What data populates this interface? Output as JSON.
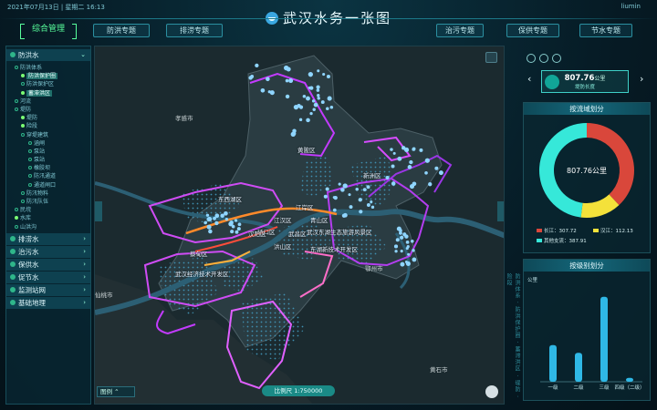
{
  "header": {
    "datetime": "2021年07月13日 | 星期二 16:13",
    "title": "武汉水务一张图",
    "user": "liumin",
    "tabs_left": [
      "综合管理",
      "防洪专题",
      "排涝专题"
    ],
    "tabs_right": [
      "治污专题",
      "保供专题",
      "节水专题"
    ]
  },
  "sidebar": {
    "groups": [
      {
        "label": "防洪水",
        "expanded": true
      },
      {
        "label": "排涝水"
      },
      {
        "label": "治污水"
      },
      {
        "label": "保供水"
      },
      {
        "label": "促节水"
      },
      {
        "label": "监测站网"
      },
      {
        "label": "基础地理"
      }
    ],
    "tree": [
      {
        "label": "防洪体系",
        "level": 1,
        "on": false
      },
      {
        "label": "防洪保护圈",
        "level": 2,
        "on": true,
        "highlight": true
      },
      {
        "label": "防洪保护区",
        "level": 2,
        "on": false
      },
      {
        "label": "蓄滞洪区",
        "level": 2,
        "on": true,
        "highlight": true
      },
      {
        "label": "河流",
        "level": 1,
        "on": false
      },
      {
        "label": "堤防",
        "level": 1,
        "on": false
      },
      {
        "label": "堤防",
        "level": 2,
        "on": true
      },
      {
        "label": "险段",
        "level": 2,
        "on": true
      },
      {
        "label": "穿堤建筑",
        "level": 2,
        "on": false
      },
      {
        "label": "涵闸",
        "level": 3,
        "on": false
      },
      {
        "label": "泵站",
        "level": 3,
        "on": false
      },
      {
        "label": "泵站",
        "level": 3,
        "on": false
      },
      {
        "label": "橡胶坝",
        "level": 3,
        "on": false
      },
      {
        "label": "防汛通道",
        "level": 3,
        "on": false
      },
      {
        "label": "通道闸口",
        "level": 3,
        "on": false
      },
      {
        "label": "防汛物料",
        "level": 2,
        "on": false
      },
      {
        "label": "防汛队伍",
        "level": 2,
        "on": false
      },
      {
        "label": "民垸",
        "level": 1,
        "on": false
      },
      {
        "label": "水库",
        "level": 1,
        "on": true
      },
      {
        "label": "山洪沟",
        "level": 1,
        "on": false
      }
    ]
  },
  "map": {
    "city_labels": [
      {
        "name": "孝感市",
        "pos": "nw"
      },
      {
        "name": "黄陂区",
        "pos": "n"
      },
      {
        "name": "新洲区",
        "pos": "ne"
      },
      {
        "name": "东西湖区",
        "pos": "w"
      },
      {
        "name": "江岸区",
        "pos": "c1"
      },
      {
        "name": "江汉区",
        "pos": "c2"
      },
      {
        "name": "硚口区",
        "pos": "c3"
      },
      {
        "name": "青山区",
        "pos": "c4"
      },
      {
        "name": "武昌区",
        "pos": "c5"
      },
      {
        "name": "洪山区",
        "pos": "c6"
      },
      {
        "name": "汉阳区",
        "pos": "c7"
      },
      {
        "name": "武汉东湖生态旅游风景区",
        "pos": "c8"
      },
      {
        "name": "东湖新技术开发区",
        "pos": "c9"
      },
      {
        "name": "蔡甸区",
        "pos": "sw"
      },
      {
        "name": "武汉经济技术开发区",
        "pos": "sw2"
      },
      {
        "name": "仙桃市",
        "pos": "w2"
      },
      {
        "name": "鄂州市",
        "pos": "e"
      },
      {
        "name": "黄石市",
        "pos": "se"
      }
    ],
    "scale": "比例尺 1:750000",
    "legend_label": "图例"
  },
  "side_strip": "防洪体系 · 防洪保护圈 · 蓄滞洪区 · 堤防 · 险段",
  "right": {
    "stat_value": "807.76",
    "stat_unit": "公里",
    "stat_sub": "堤防长度",
    "panel1_title": "按流域划分",
    "donut_center": "807.76公里",
    "panel2_title": "按级别划分",
    "colors": {
      "changjiang": "#d9473b",
      "hanjiang": "#f4e13a",
      "other": "#36e8d9",
      "bar": "#2fb8e6"
    }
  },
  "chart_data": [
    {
      "type": "pie",
      "title": "按流域划分",
      "center_label": "807.76公里",
      "series": [
        {
          "name": "长江",
          "value": 307.72
        },
        {
          "name": "汉江",
          "value": 112.13
        },
        {
          "name": "其他支流",
          "value": 387.91
        }
      ]
    },
    {
      "type": "bar",
      "title": "按级别划分",
      "ylabel": "公里",
      "categories": [
        "一级",
        "二级",
        "三级",
        "四级（二级）"
      ],
      "values": [
        190,
        150,
        440,
        20
      ]
    }
  ]
}
